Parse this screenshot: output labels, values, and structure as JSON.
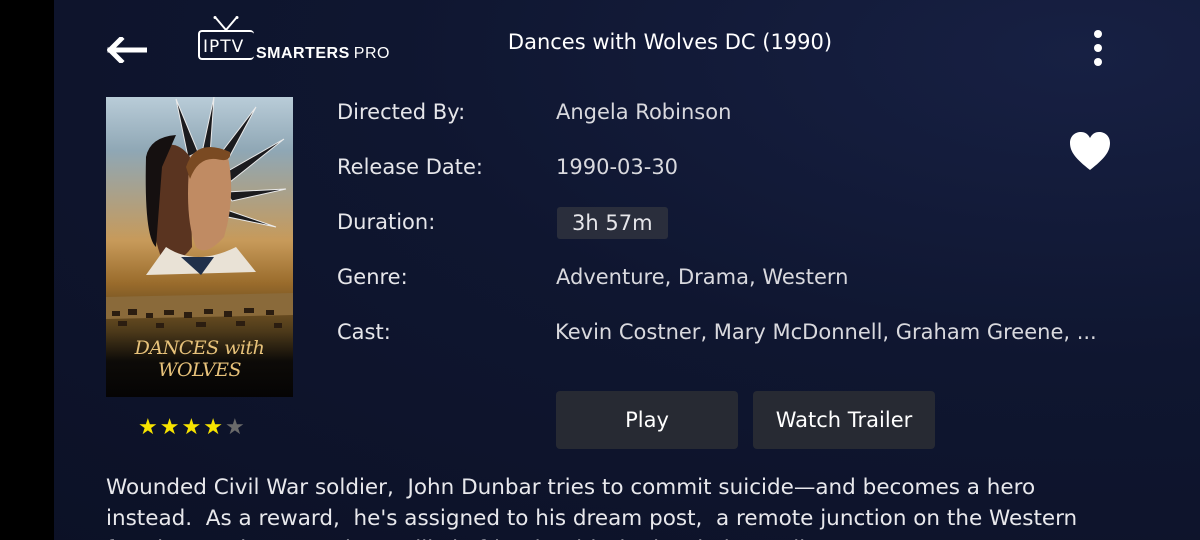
{
  "header": {
    "back_icon": "arrow-left-icon",
    "logo": {
      "iptv": "IPTV",
      "smarters": "SMARTERS",
      "pro": "PRO"
    },
    "title": "Dances with Wolves DC (1990)",
    "menu_icon": "kebab-menu-icon"
  },
  "poster": {
    "title_art": "DANCES with WOLVES"
  },
  "rating": {
    "stars_filled": 4,
    "stars_total": 5
  },
  "details": {
    "directed_by": {
      "label": "Directed By:",
      "value": "Angela Robinson"
    },
    "release_date": {
      "label": "Release Date:",
      "value": "1990-03-30"
    },
    "duration": {
      "label": "Duration:",
      "value": "3h 57m"
    },
    "genre": {
      "label": "Genre:",
      "value": "Adventure,  Drama,  Western"
    },
    "cast": {
      "label": "Cast:",
      "value": "Kevin Costner,  Mary McDonnell,  Graham Greene,  ..."
    }
  },
  "favorite_icon": "heart-icon",
  "buttons": {
    "play": "Play",
    "trailer": "Watch Trailer"
  },
  "description": "Wounded Civil War soldier,  John Dunbar tries to commit suicide—and becomes a hero\ninstead.  As a reward,  he's assigned to his dream post,  a remote junction on the Western\nfrontier,  and soon makes unlikely friends with the local Sioux tribe.",
  "colors": {
    "background": "#0f1630",
    "button": "#272a33",
    "star_filled": "#f7e300",
    "star_empty": "#6a6a6a"
  }
}
